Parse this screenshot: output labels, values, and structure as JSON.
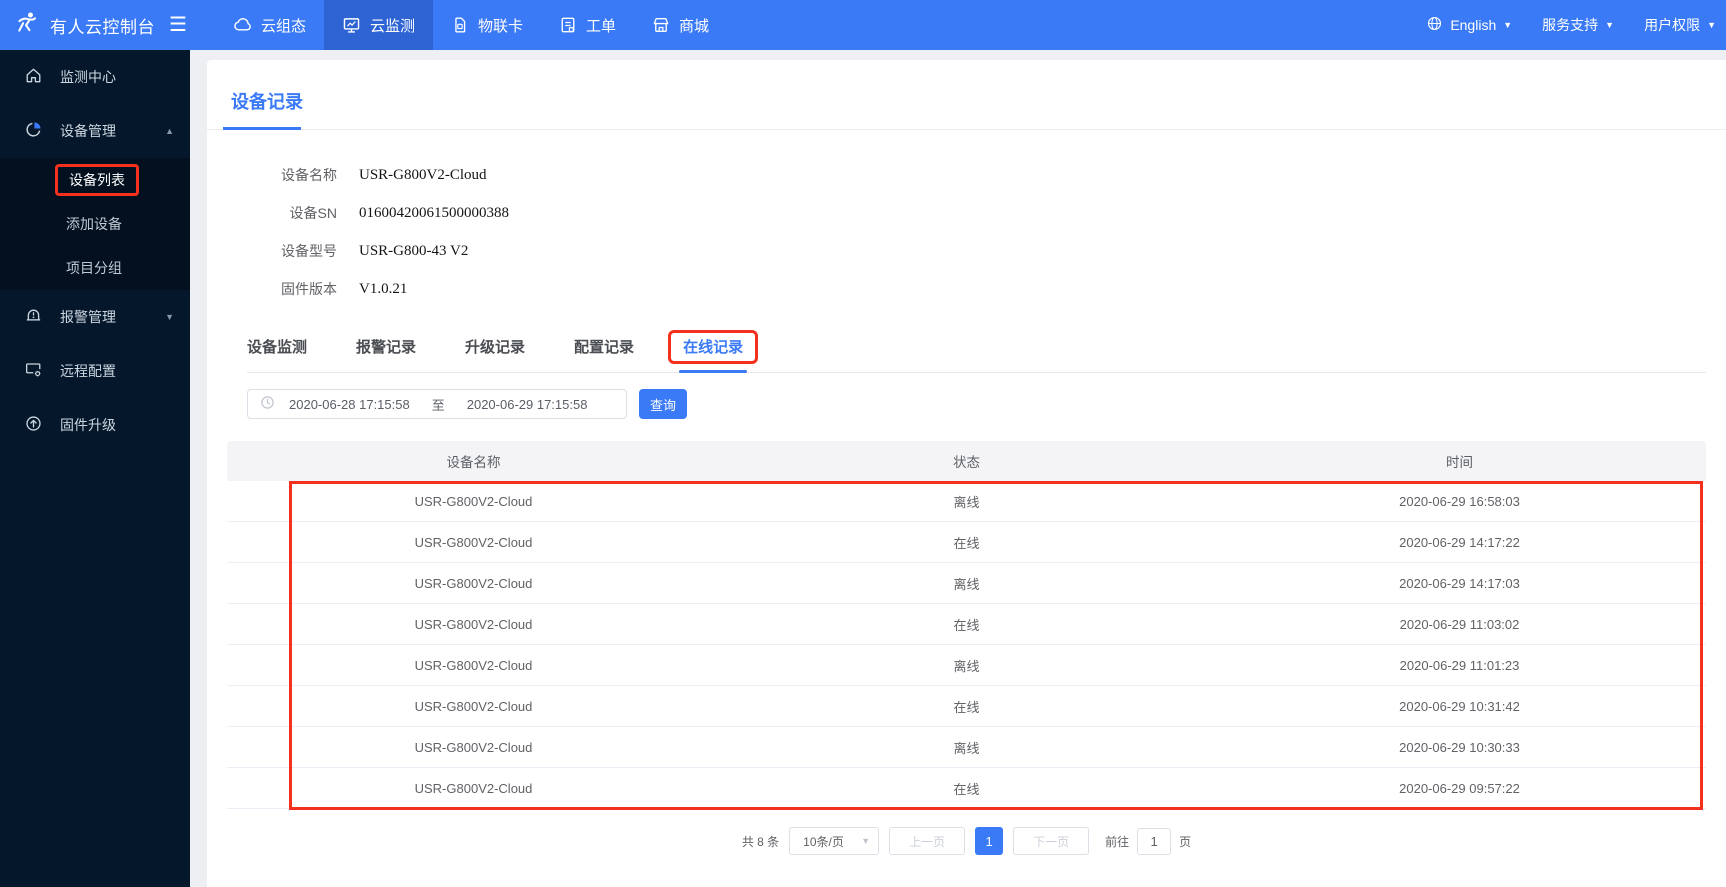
{
  "colors": {
    "accent_blue": "#3b7af6",
    "topbar_active_blue": "#2e63d4",
    "annotation_red": "#f4301f",
    "sidebar_bg": "#05182b"
  },
  "topbar": {
    "brand": "有人云控制台",
    "nav": [
      {
        "label": "云组态",
        "icon": "cloud-icon",
        "active": false
      },
      {
        "label": "云监测",
        "icon": "monitor-chart-icon",
        "active": true
      },
      {
        "label": "物联卡",
        "icon": "sim-card-icon",
        "active": false
      },
      {
        "label": "工单",
        "icon": "work-order-icon",
        "active": false
      },
      {
        "label": "商城",
        "icon": "store-icon",
        "active": false
      }
    ],
    "language": "English",
    "support": "服务支持",
    "account": "用户权限"
  },
  "sidebar": {
    "items": [
      {
        "label": "监测中心",
        "icon": "home-icon"
      },
      {
        "label": "设备管理",
        "icon": "pie-chart-icon",
        "expanded": true,
        "children": [
          "设备列表",
          "添加设备",
          "项目分组"
        ],
        "active_child": "设备列表"
      },
      {
        "label": "报警管理",
        "icon": "alarm-bell-icon",
        "expanded": false
      },
      {
        "label": "远程配置",
        "icon": "remote-config-icon"
      },
      {
        "label": "固件升级",
        "icon": "firmware-upgrade-icon"
      }
    ]
  },
  "main": {
    "page_title": "设备记录",
    "device_info": [
      {
        "label": "设备名称",
        "value": "USR-G800V2-Cloud"
      },
      {
        "label": "设备SN",
        "value": "01600420061500000388"
      },
      {
        "label": "设备型号",
        "value": "USR-G800-43 V2"
      },
      {
        "label": "固件版本",
        "value": "V1.0.21"
      }
    ],
    "tabs": [
      "设备监测",
      "报警记录",
      "升级记录",
      "配置记录",
      "在线记录"
    ],
    "active_tab": "在线记录",
    "filter": {
      "start": "2020-06-28 17:15:58",
      "separator": "至",
      "end": "2020-06-29 17:15:58",
      "search_button": "查询"
    },
    "table": {
      "headers": [
        "设备名称",
        "状态",
        "时间"
      ],
      "rows": [
        {
          "name": "USR-G800V2-Cloud",
          "status": "离线",
          "time": "2020-06-29 16:58:03"
        },
        {
          "name": "USR-G800V2-Cloud",
          "status": "在线",
          "time": "2020-06-29 14:17:22"
        },
        {
          "name": "USR-G800V2-Cloud",
          "status": "离线",
          "time": "2020-06-29 14:17:03"
        },
        {
          "name": "USR-G800V2-Cloud",
          "status": "在线",
          "time": "2020-06-29 11:03:02"
        },
        {
          "name": "USR-G800V2-Cloud",
          "status": "离线",
          "time": "2020-06-29 11:01:23"
        },
        {
          "name": "USR-G800V2-Cloud",
          "status": "在线",
          "time": "2020-06-29 10:31:42"
        },
        {
          "name": "USR-G800V2-Cloud",
          "status": "离线",
          "time": "2020-06-29 10:30:33"
        },
        {
          "name": "USR-G800V2-Cloud",
          "status": "在线",
          "time": "2020-06-29 09:57:22"
        }
      ]
    },
    "pagination": {
      "total": "共 8 条",
      "page_size": "10条/页",
      "prev": "上一页",
      "current_page": "1",
      "next": "下一页",
      "goto_label": "前往",
      "goto_value": "1",
      "page_unit": "页"
    }
  }
}
